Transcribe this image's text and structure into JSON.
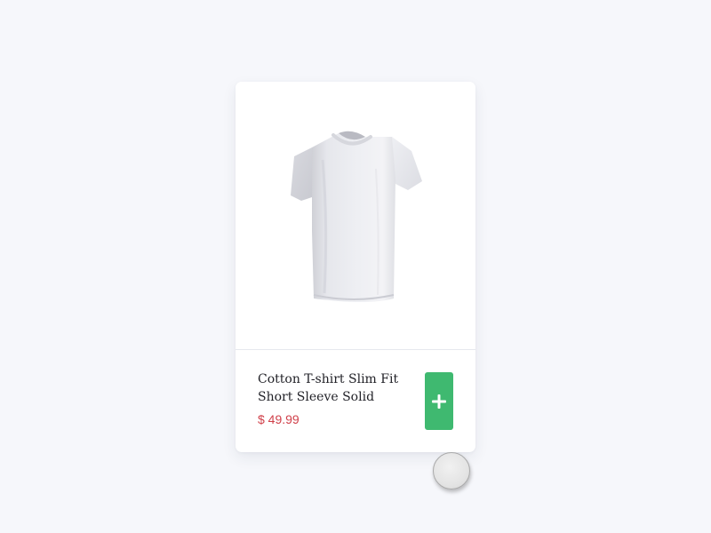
{
  "product": {
    "title": "Cotton T-shirt Slim Fit Short Sleeve Solid",
    "price": "$ 49.99",
    "image_icon": "white-tshirt-image",
    "add_icon": "plus-icon"
  },
  "colors": {
    "background": "#f6f7fb",
    "card": "#ffffff",
    "add_button": "#3fb970",
    "price": "#d0404a",
    "title": "#222228"
  }
}
